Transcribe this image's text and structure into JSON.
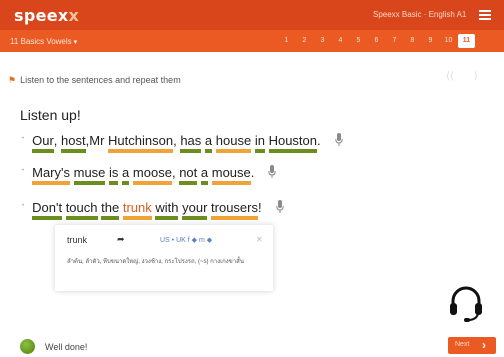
{
  "app": {
    "logo_main": "speex",
    "logo_accent": "x",
    "course_title": "Speexx Basic · English A1",
    "menu_icon": "hamburger-icon"
  },
  "unit_bar": {
    "unit_label": "11 Basics Vowels",
    "pages": [
      "1",
      "2",
      "3",
      "4",
      "5",
      "6",
      "7",
      "8",
      "9",
      "10",
      "11"
    ],
    "active_page": "11"
  },
  "exercise": {
    "instruction": "Listen to the sentences and repeat them",
    "heading": "Listen up!",
    "sentences": [
      [
        {
          "t": "Our",
          "u": "g"
        },
        {
          "t": ","
        },
        {
          "t": "host",
          "u": "g"
        },
        {
          "t": ","
        },
        {
          "t": "Mr"
        },
        {
          "t": "Hutchinson",
          "u": "o"
        },
        {
          "t": ","
        },
        {
          "t": "has",
          "u": "g"
        },
        {
          "t": "a",
          "u": "g"
        },
        {
          "t": "house",
          "u": "o"
        },
        {
          "t": "in",
          "u": "g"
        },
        {
          "t": "Houston",
          "u": "g"
        },
        {
          "t": "."
        }
      ],
      [
        {
          "t": "Mary's",
          "u": "o"
        },
        {
          "t": "muse",
          "u": "g"
        },
        {
          "t": "is",
          "u": "g"
        },
        {
          "t": "a",
          "u": "g"
        },
        {
          "t": "moose",
          "u": "o"
        },
        {
          "t": ","
        },
        {
          "t": "not",
          "u": "g"
        },
        {
          "t": "a",
          "u": "g"
        },
        {
          "t": "mouse",
          "u": "o"
        },
        {
          "t": "."
        }
      ],
      [
        {
          "t": "Don't",
          "u": "g"
        },
        {
          "t": "touch",
          "u": "g"
        },
        {
          "t": "the",
          "u": "g"
        },
        {
          "t": "trunk",
          "u": "o",
          "hl": true
        },
        {
          "t": "with",
          "u": "g"
        },
        {
          "t": "your",
          "u": "g"
        },
        {
          "t": "trousers",
          "u": "o"
        },
        {
          "t": "!"
        }
      ]
    ]
  },
  "popup": {
    "word": "trunk",
    "lang_options": "US • UK  f ◆  m ◆",
    "definition": "ลำต้น, ลำตัว, หีบขนาดใหญ่, งวงช้าง, กระโปรงรถ, (~s) กางเกงขาสั้น"
  },
  "feedback": {
    "text": "Well done!"
  },
  "next_button": {
    "label": "Next"
  },
  "colors": {
    "brand": "#d9461b",
    "subbar": "#eb5a23",
    "underline_good": "#6c8e1f",
    "underline_warn": "#f0a336",
    "highlight": "#e25b1c"
  }
}
